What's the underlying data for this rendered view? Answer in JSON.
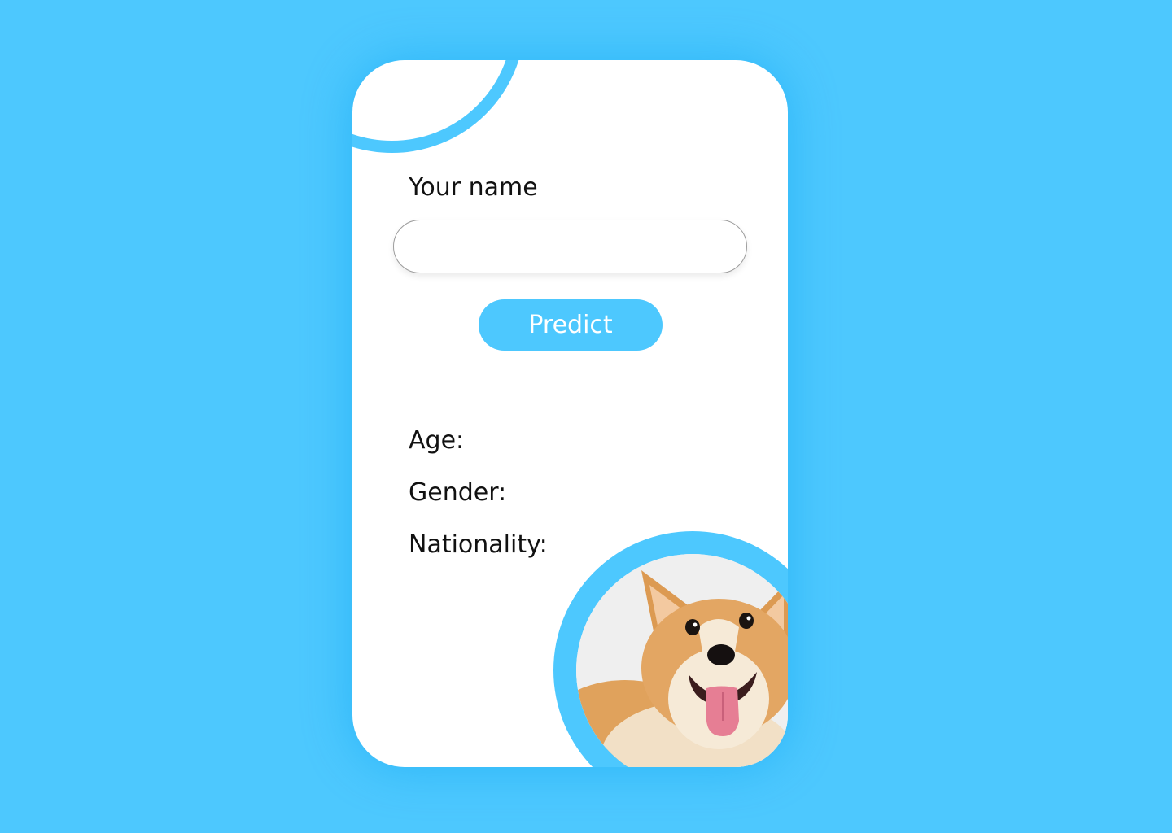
{
  "colors": {
    "background": "#4dc8fe",
    "card": "#ffffff",
    "accent": "#4dc8fe",
    "text": "#111111"
  },
  "form": {
    "name_label": "Your name",
    "name_value": "",
    "name_placeholder": "",
    "predict_label": "Predict"
  },
  "results": {
    "age_label": "Age:",
    "gender_label": "Gender:",
    "nationality_label": "Nationality:"
  },
  "image": {
    "subject": "corgi-dog-photo"
  }
}
